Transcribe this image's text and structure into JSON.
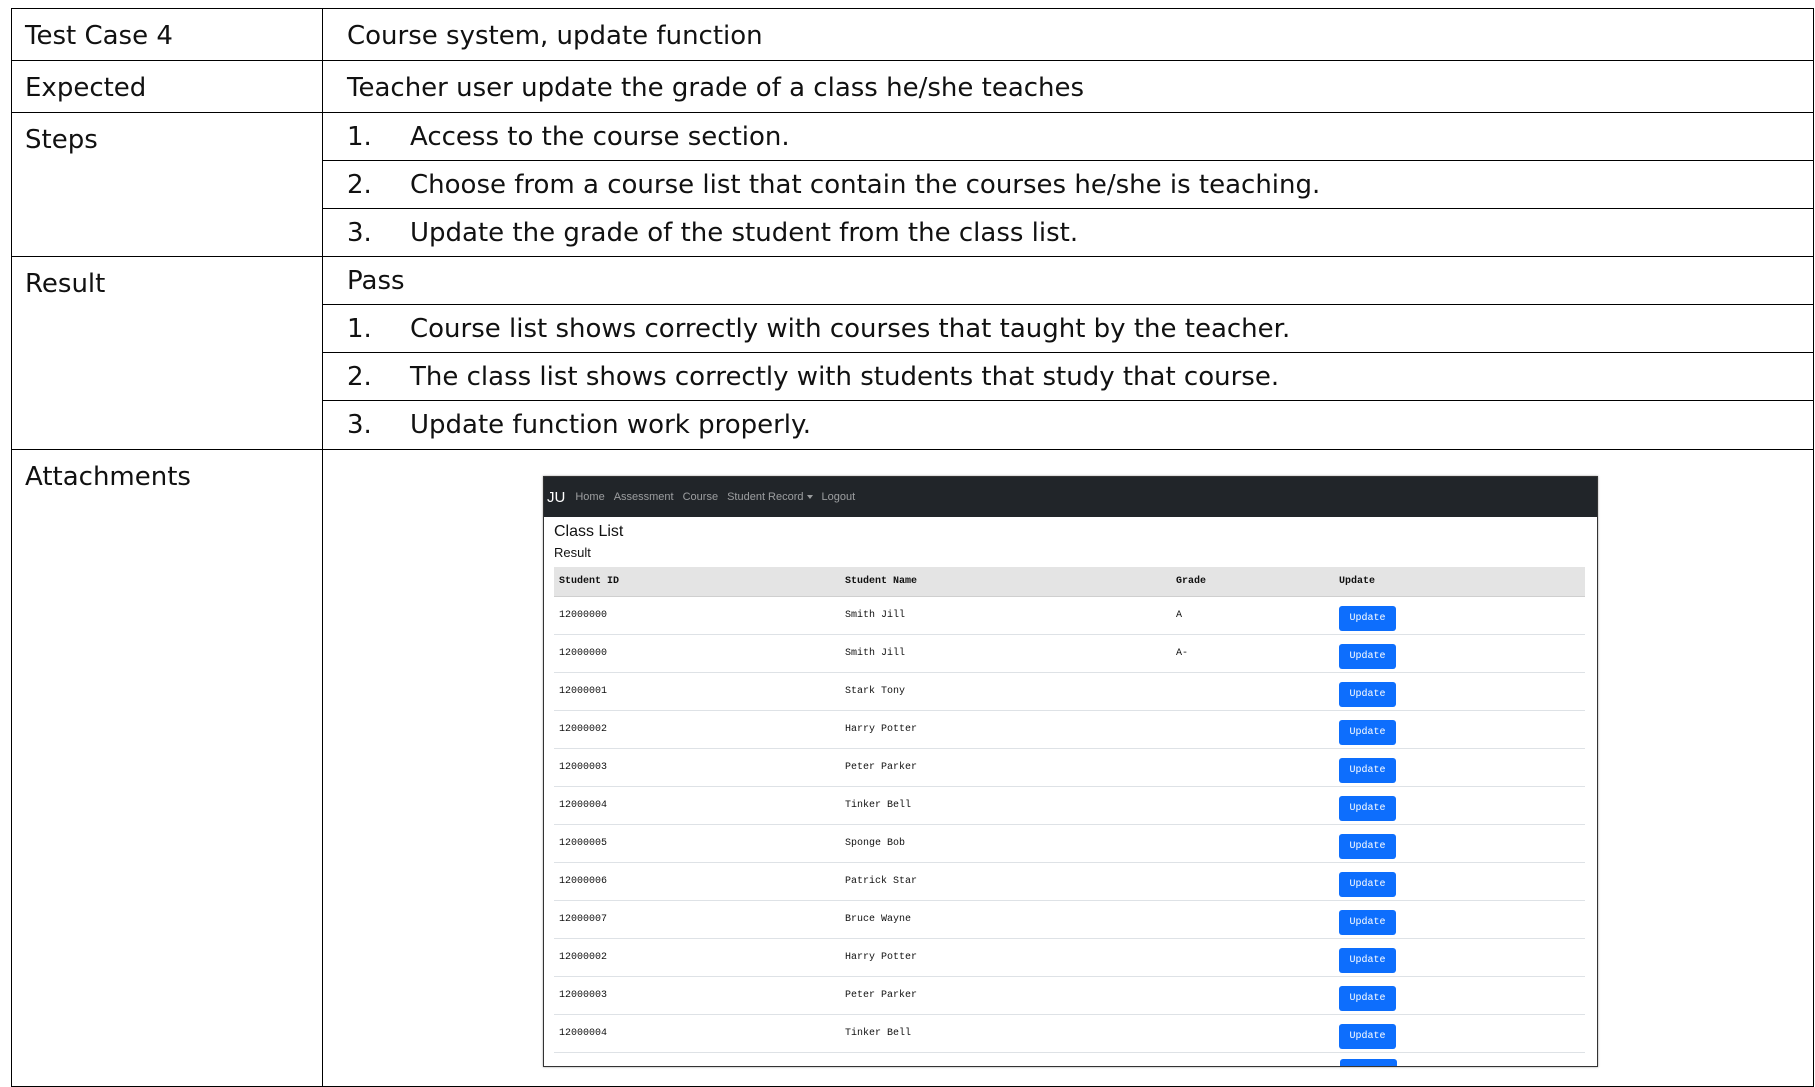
{
  "test_case": {
    "id_label": "Test Case 4",
    "title": "Course system, update function",
    "expected_label": "Expected",
    "expected_text": "Teacher user update the grade of a class he/she teaches",
    "steps_label": "Steps",
    "steps": [
      {
        "num": "1.",
        "text": "Access to the course section."
      },
      {
        "num": "2.",
        "text": "Choose from a course list that contain the courses he/she is teaching."
      },
      {
        "num": "3.",
        "text": "Update the grade of the student from the class list."
      }
    ],
    "result_label": "Result",
    "result_status": "Pass",
    "results": [
      {
        "num": "1.",
        "text": "Course list shows correctly with courses that taught by the teacher."
      },
      {
        "num": "2.",
        "text": "The class list shows correctly with students that study that course."
      },
      {
        "num": "3.",
        "text": "Update function work properly."
      }
    ],
    "attachments_label": "Attachments"
  },
  "attachment": {
    "brand": "JU",
    "nav": [
      "Home",
      "Assessment",
      "Course",
      "Student Record",
      "Logout"
    ],
    "heading": "Class List",
    "subheading": "Result",
    "columns": [
      "Student ID",
      "Student Name",
      "Grade",
      "Update"
    ],
    "button_label": "Update",
    "rows": [
      {
        "id": "12000000",
        "name": "Smith Jill",
        "grade": "A"
      },
      {
        "id": "12000000",
        "name": "Smith Jill",
        "grade": "A-"
      },
      {
        "id": "12000001",
        "name": "Stark Tony",
        "grade": ""
      },
      {
        "id": "12000002",
        "name": "Harry Potter",
        "grade": ""
      },
      {
        "id": "12000003",
        "name": "Peter Parker",
        "grade": ""
      },
      {
        "id": "12000004",
        "name": "Tinker Bell",
        "grade": ""
      },
      {
        "id": "12000005",
        "name": "Sponge Bob",
        "grade": ""
      },
      {
        "id": "12000006",
        "name": "Patrick Star",
        "grade": ""
      },
      {
        "id": "12000007",
        "name": "Bruce Wayne",
        "grade": ""
      },
      {
        "id": "12000002",
        "name": "Harry Potter",
        "grade": ""
      },
      {
        "id": "12000003",
        "name": "Peter Parker",
        "grade": ""
      },
      {
        "id": "12000004",
        "name": "Tinker Bell",
        "grade": ""
      }
    ]
  }
}
